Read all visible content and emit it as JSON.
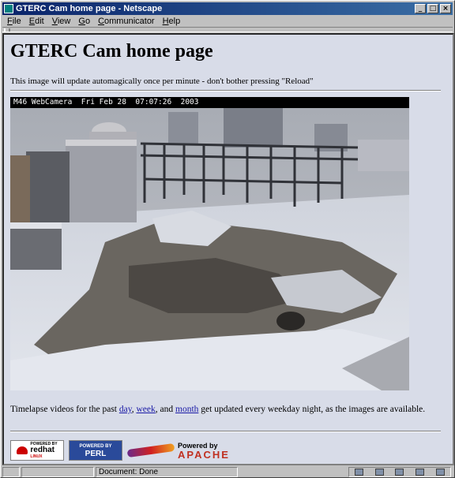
{
  "window": {
    "title": "GTERC Cam home page - Netscape",
    "buttons": {
      "minimize": "_",
      "maximize": "□",
      "close": "×"
    }
  },
  "menu": {
    "items": [
      {
        "label": "File"
      },
      {
        "label": "Edit"
      },
      {
        "label": "View"
      },
      {
        "label": "Go"
      },
      {
        "label": "Communicator"
      },
      {
        "label": "Help"
      }
    ]
  },
  "page": {
    "heading": "GTERC Cam home page",
    "intro": "This image will update automagically once per minute - don't bother pressing \"Reload\"",
    "camera_caption": "M46 WebCamera  Fri Feb 28  07:07:26  2003",
    "timelapse": {
      "prefix": "Timelapse videos for the past ",
      "link_day": "day",
      "sep1": ", ",
      "link_week": "week",
      "sep2": ", and ",
      "link_month": "month",
      "suffix": " get updated every weekday night, as the images are available."
    },
    "badges": {
      "redhat_line1": "POWERED BY",
      "redhat_line2": "redhat",
      "redhat_line3": "LINUX",
      "perl_line1": "POWERED BY",
      "perl_line2": "PERL",
      "apache_line1": "Powered by",
      "apache_line2": "APACHE"
    }
  },
  "status": {
    "text": "Document: Done"
  },
  "colors": {
    "titlebar": "#0a246a",
    "page_background": "#d8dce8",
    "link": "#1a1aa6"
  }
}
